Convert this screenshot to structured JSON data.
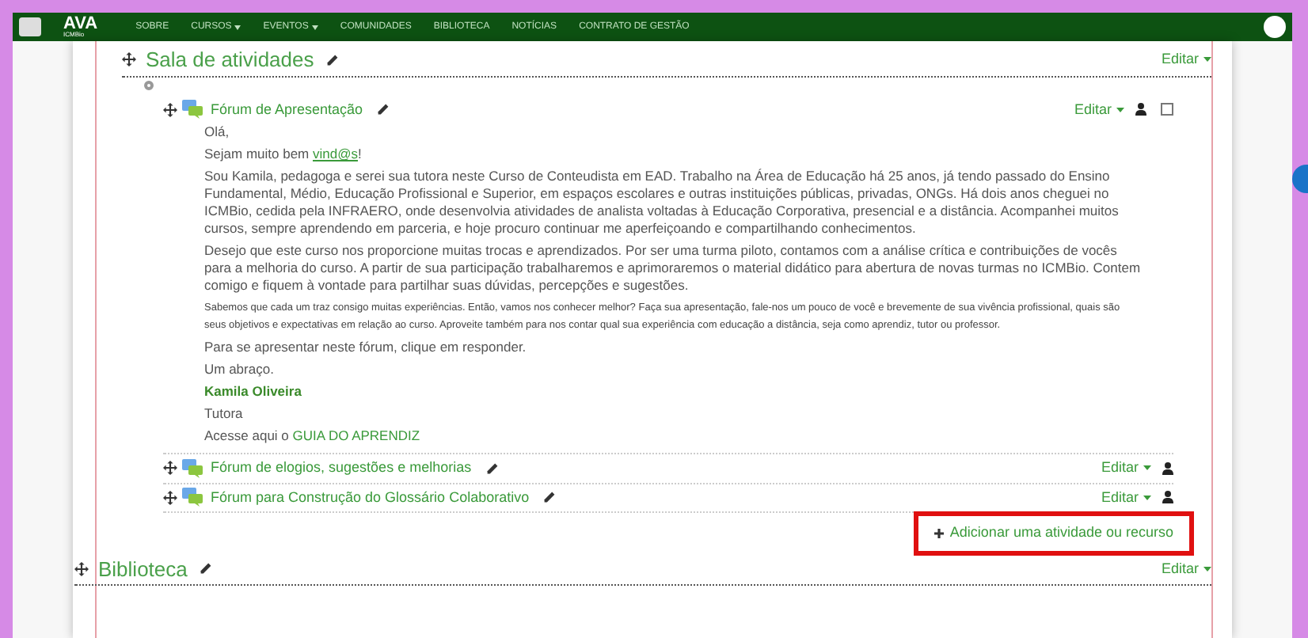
{
  "nav": {
    "logo_title": "AVA",
    "logo_subtitle": "ICMBio",
    "menu": [
      {
        "label": "SOBRE",
        "dropdown": false
      },
      {
        "label": "CURSOS",
        "dropdown": true
      },
      {
        "label": "EVENTOS",
        "dropdown": true
      },
      {
        "label": "COMUNIDADES",
        "dropdown": false
      },
      {
        "label": "BIBLIOTECA",
        "dropdown": false
      },
      {
        "label": "NOTÍCIAS",
        "dropdown": false
      },
      {
        "label": "CONTRATO DE GESTÃO",
        "dropdown": false
      }
    ]
  },
  "sections": [
    {
      "title": "Sala de atividades",
      "edit_label": "Editar",
      "activities": [
        {
          "name": "Fórum de Apresentação",
          "edit_label": "Editar",
          "completion": {
            "checked": false
          },
          "description": [
            {
              "kind": "text",
              "parts": [
                {
                  "text": "Olá,",
                  "link": false
                }
              ]
            },
            {
              "kind": "text",
              "parts": [
                {
                  "text": "Sejam muito bem ",
                  "link": false
                },
                {
                  "text": "vind@s",
                  "link": true
                },
                {
                  "text": "!",
                  "link": false
                }
              ]
            },
            {
              "kind": "text",
              "parts": [
                {
                  "text": "Sou Kamila, pedagoga e serei sua tutora neste Curso de Conteudista em EAD. Trabalho na Área de Educação há 25 anos, já tendo passado do Ensino Fundamental, Médio, Educação Profissional e Superior, em espaços escolares e outras instituições públicas, privadas, ONGs. Há dois anos cheguei no ICMBio, cedida pela INFRAERO, onde desenvolvia atividades de analista voltadas à Educação Corporativa, presencial e a distância. Acompanhei muitos cursos, sempre aprendendo em parceria, e hoje procuro continuar me aperfeiçoando e compartilhando conhecimentos.",
                  "link": false
                }
              ]
            },
            {
              "kind": "text",
              "parts": [
                {
                  "text": "Desejo que este curso nos proporcione muitas trocas e aprendizados. Por ser uma turma piloto, contamos com a análise crítica e contribuições de vocês para a melhoria do curso. A partir de sua participação trabalharemos e aprimoraremos o material didático para abertura de novas turmas no ICMBio. Contem comigo e fiquem à vontade para partilhar suas dúvidas, percepções e sugestões.",
                  "link": false
                }
              ]
            },
            {
              "kind": "small",
              "parts": [
                {
                  "text": "Sabemos que cada um traz consigo muitas experiências. Então, vamos nos conhecer melhor? Faça sua apresentação, fale-nos um pouco de você e brevemente de sua vivência profissional, quais são seus objetivos e expectativas em relação ao curso. Aproveite também para nos contar qual sua experiência com educação a distância, seja como aprendiz, tutor ou professor.",
                  "link": false
                }
              ]
            },
            {
              "kind": "text",
              "parts": [
                {
                  "text": "Para se apresentar neste fórum, clique em responder.",
                  "link": false
                }
              ]
            },
            {
              "kind": "text",
              "parts": [
                {
                  "text": "Um abraço.",
                  "link": false
                }
              ]
            },
            {
              "kind": "signature",
              "parts": [
                {
                  "text": "Kamila Oliveira",
                  "link": false
                }
              ]
            },
            {
              "kind": "text",
              "parts": [
                {
                  "text": "Tutora",
                  "link": false
                }
              ]
            },
            {
              "kind": "text",
              "parts": [
                {
                  "text": "Acesse aqui o ",
                  "link": false
                },
                {
                  "text": "GUIA DO APRENDIZ",
                  "link": true
                }
              ]
            }
          ]
        },
        {
          "name": "Fórum de elogios, sugestões e melhorias",
          "edit_label": "Editar"
        },
        {
          "name": "Fórum para Construção do Glossário Colaborativo",
          "edit_label": "Editar"
        }
      ],
      "add_link": {
        "label": "Adicionar uma atividade ou recurso",
        "highlighted": true
      }
    },
    {
      "title": "Biblioteca",
      "edit_label": "Editar"
    }
  ]
}
